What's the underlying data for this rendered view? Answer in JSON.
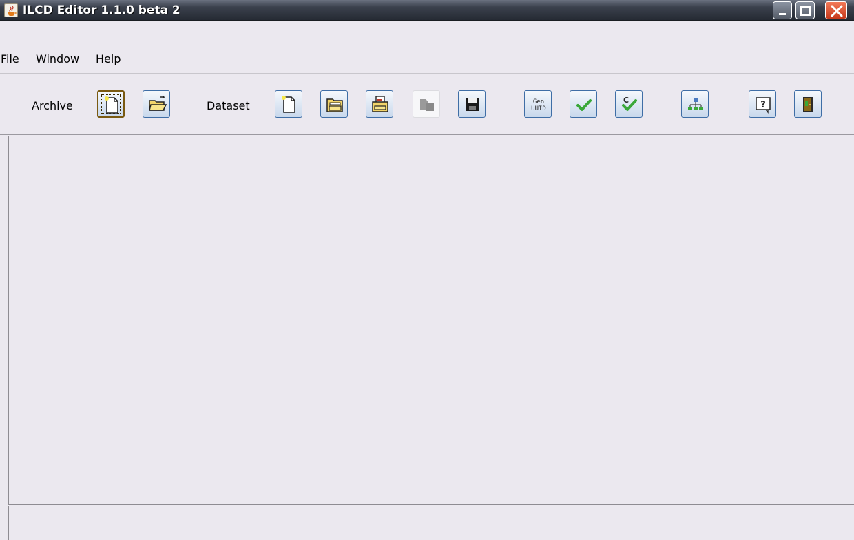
{
  "window": {
    "title": "ILCD Editor 1.1.0 beta 2",
    "app_icon": "java-cup-icon",
    "controls": [
      "minimize-icon",
      "maximize-icon",
      "close-icon"
    ]
  },
  "menu": {
    "items": [
      "File",
      "Window",
      "Help"
    ]
  },
  "toolbar": {
    "archive_label": "Archive",
    "dataset_label": "Dataset",
    "gen_uuid_line1": "Gen",
    "gen_uuid_line2": "UUID",
    "buttons": [
      {
        "icon": "new-document-icon",
        "group": "Archive",
        "state": "focused"
      },
      {
        "icon": "open-folder-icon",
        "group": "Archive",
        "state": "enabled"
      },
      {
        "icon": "new-document-icon",
        "group": "Dataset",
        "state": "enabled"
      },
      {
        "icon": "open-file-folder-icon",
        "group": "Dataset",
        "state": "enabled"
      },
      {
        "icon": "open-recent-folder-icon",
        "group": "Dataset",
        "state": "enabled"
      },
      {
        "icon": "close-dataset-icon",
        "group": "Dataset",
        "state": "disabled"
      },
      {
        "icon": "save-disk-icon",
        "group": "Dataset",
        "state": "enabled"
      },
      {
        "icon": "generate-uuid-icon",
        "group": "Tools",
        "state": "enabled"
      },
      {
        "icon": "validate-checkmark-icon",
        "group": "Tools",
        "state": "enabled"
      },
      {
        "icon": "check-compliance-icon",
        "group": "Tools",
        "state": "enabled"
      },
      {
        "icon": "hierarchy-tree-icon",
        "group": "Tools",
        "state": "enabled"
      },
      {
        "icon": "help-icon",
        "group": "Tools",
        "state": "enabled"
      },
      {
        "icon": "exit-door-icon",
        "group": "Tools",
        "state": "enabled"
      }
    ]
  },
  "colors": {
    "window_background": "#ebe8ef",
    "button_border": "#3f6ea6",
    "validate_green": "#3aa83a"
  }
}
